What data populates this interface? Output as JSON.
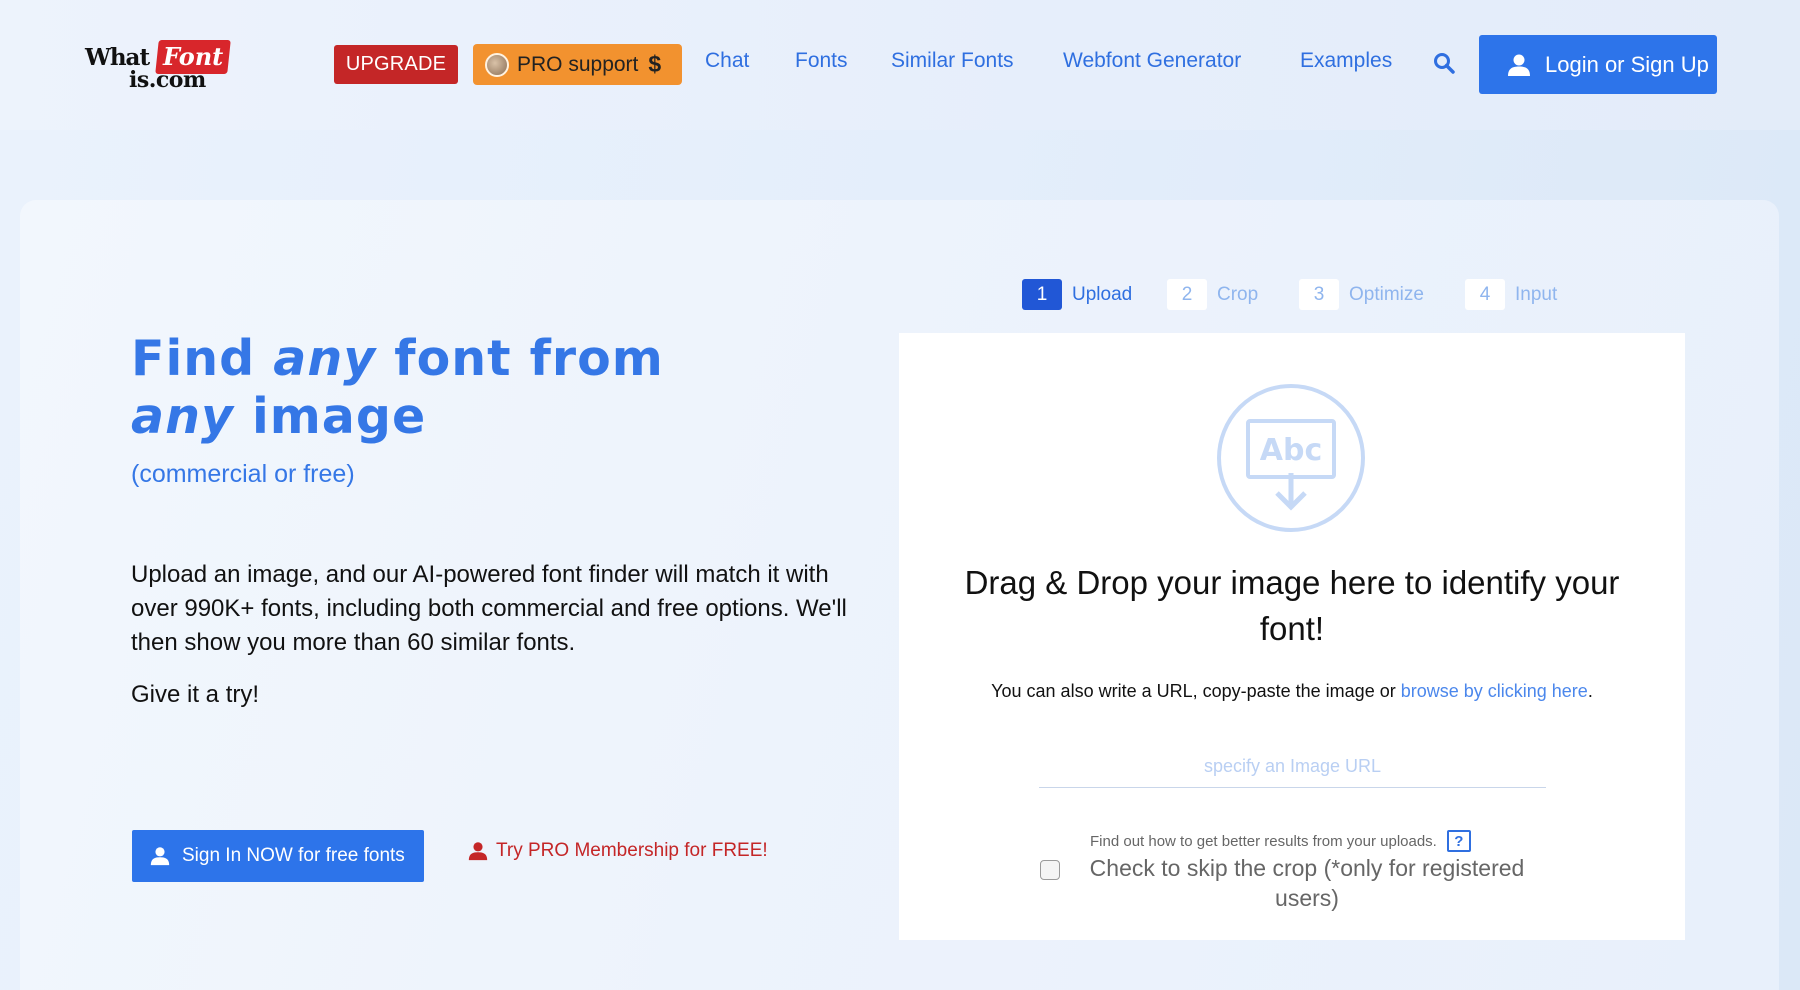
{
  "header": {
    "logo": {
      "what": "What",
      "font": "Font",
      "is": "is.com"
    },
    "upgrade_label": "UPGRADE",
    "pro_support_label": "PRO support",
    "pro_support_symbol": "$",
    "nav": [
      "Chat",
      "Fonts",
      "Similar Fonts",
      "Webfont Generator",
      "Examples"
    ],
    "search_icon": "search-icon",
    "login_label": "Login or Sign Up"
  },
  "hero": {
    "headline_1": "Find ",
    "headline_any_1": "any",
    "headline_2": " font from ",
    "headline_any_2": "any",
    "headline_3": " image",
    "subtitle": "(commercial or free)",
    "description": "Upload an image, and our AI-powered font finder will match it with over 990K+ fonts, including both commercial and free options. We'll then show you more than 60 similar fonts.",
    "try_text": "Give it a try!",
    "signin_label": "Sign In NOW for free fonts",
    "pro_trial_label": "Try PRO Membership for FREE!"
  },
  "steps": [
    {
      "num": "1",
      "label": "Upload",
      "active": true
    },
    {
      "num": "2",
      "label": "Crop",
      "active": false
    },
    {
      "num": "3",
      "label": "Optimize",
      "active": false
    },
    {
      "num": "4",
      "label": "Input",
      "active": false
    }
  ],
  "upload": {
    "icon_text": "Abc",
    "title": "Drag & Drop your image here to identify your font!",
    "also_prefix": "You can also write a URL, copy-paste the image or ",
    "browse_label": "browse by clicking here",
    "also_suffix": ".",
    "url_placeholder": "specify an Image URL",
    "url_value": "",
    "findout_text": "Find out how to get better results from your uploads.",
    "help_label": "?",
    "skip_crop_label": "Check to skip the crop (*only for registered users)",
    "skip_crop_checked": false
  },
  "colors": {
    "accent": "#2d74ea",
    "link": "#2f6fe0",
    "upgrade": "#c42627",
    "pro_orange": "#f2922f",
    "logo_red": "#d8262b"
  }
}
